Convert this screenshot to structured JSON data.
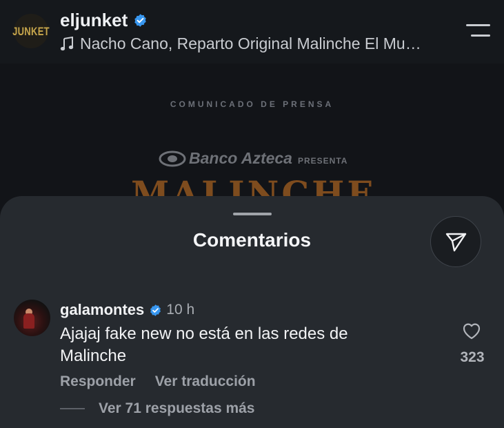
{
  "post": {
    "avatar_text": "JUNKET",
    "username": "eljunket",
    "verified": true,
    "audio": "Nacho Cano, Reparto Original Malinche El Mu…"
  },
  "media": {
    "press_label": "COMUNICADO DE PRENSA",
    "sponsor": "Banco Azteca",
    "sponsor_presents": "PRESENTA",
    "show_title": "MALINCHE"
  },
  "comments_sheet": {
    "title": "Comentarios",
    "comments": [
      {
        "username": "galamontes",
        "verified": true,
        "time": "10 h",
        "text": "Ajajaj fake new no está en las redes de Malinche",
        "likes": "323",
        "reply_label": "Responder",
        "translate_label": "Ver traducción",
        "more_replies": "Ver 71 respuestas más"
      }
    ]
  },
  "colors": {
    "background": "#121417",
    "sheet": "#262a2f",
    "verified_blue": "#3897f0",
    "secondary_text": "#9da1a8"
  },
  "icons": [
    "music-note-icon",
    "menu-icon",
    "verified-badge-icon",
    "paper-plane-icon",
    "heart-icon",
    "bank-logo-icon"
  ]
}
